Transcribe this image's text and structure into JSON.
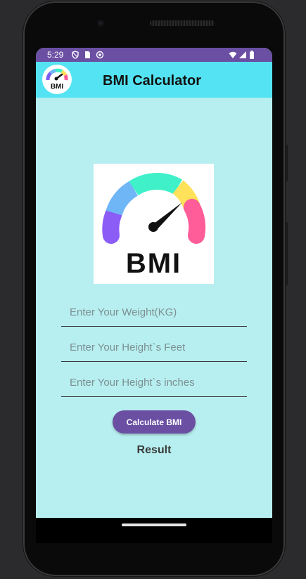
{
  "statusbar": {
    "time": "5:29",
    "icons": [
      "settings-shield-icon",
      "sim-card-icon",
      "notification-icon",
      "wifi-icon",
      "signal-icon",
      "battery-icon"
    ]
  },
  "appbar": {
    "title": "BMI Calculator",
    "logo_text": "BMI"
  },
  "hero": {
    "label": "BMI"
  },
  "form": {
    "weight_placeholder": "Enter Your Weight(KG)",
    "feet_placeholder": "Enter Your Height`s Feet",
    "inches_placeholder": "Enter Your Height`s inches",
    "calculate_label": "Calculate BMI"
  },
  "result": {
    "label": "Result"
  },
  "colors": {
    "status_bar": "#6a4fa3",
    "app_bar": "#54e3f2",
    "background": "#b7eff0",
    "button": "#6a4fa3"
  }
}
